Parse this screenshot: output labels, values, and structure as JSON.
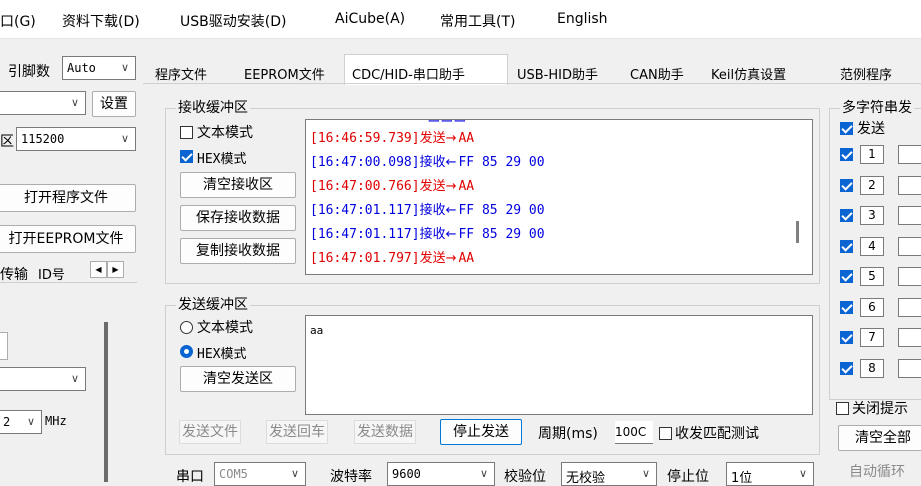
{
  "menu": [
    "口(G)",
    "资料下载(D)",
    "USB驱动安装(D)",
    "AiCube(A)",
    "常用工具(T)",
    "English"
  ],
  "left": {
    "pin_label": "引脚数",
    "pin_value": "Auto",
    "settings_button": "设置",
    "baud_label_fragment": "区",
    "baud_value": "115200",
    "open_program_button": "打开程序文件",
    "open_eeprom_button": "打开EEPROM文件",
    "transfer_label": "传输",
    "id_label": "ID号",
    "mhz_value": "2",
    "mhz_unit": "MHz"
  },
  "tabs": [
    "程序文件",
    "EEPROM文件",
    "CDC/HID-串口助手",
    "USB-HID助手",
    "CAN助手",
    "Keil仿真设置",
    "范例程序"
  ],
  "receive": {
    "title": "接收缓冲区",
    "text_mode": "文本模式",
    "hex_mode": "HEX模式",
    "clear_button": "清空接收区",
    "save_button": "保存接收数据",
    "copy_button": "复制接收数据",
    "log": [
      {
        "time": "[16:46:59.739]",
        "dir": "发送→",
        "data": "AA",
        "color": "#e00000"
      },
      {
        "time": "[16:47:00.098]",
        "dir": "接收←",
        "data": "FF 85 29 00",
        "color": "#0000e0"
      },
      {
        "time": "[16:47:00.766]",
        "dir": "发送→",
        "data": "AA",
        "color": "#e00000"
      },
      {
        "time": "[16:47:01.117]",
        "dir": "接收←",
        "data": "FF 85 29 00",
        "color": "#0000e0"
      },
      {
        "time": "[16:47:01.117]",
        "dir": "接收←",
        "data": "FF 85 29 00",
        "color": "#0000e0"
      },
      {
        "time": "[16:47:01.797]",
        "dir": "发送→",
        "data": "AA",
        "color": "#e00000"
      }
    ]
  },
  "send": {
    "title": "发送缓冲区",
    "text_mode": "文本模式",
    "hex_mode": "HEX模式",
    "clear_button": "清空发送区",
    "content": "aa",
    "send_file": "发送文件",
    "send_enter": "发送回车",
    "send_data": "发送数据",
    "stop_send": "停止发送",
    "period_label": "周期(ms)",
    "period_value": "100C",
    "loopback_label": "收发匹配测试"
  },
  "bottom": {
    "port_label": "串口",
    "port_value": "COM5",
    "baud_label": "波特率",
    "baud_value": "9600",
    "parity_label": "校验位",
    "parity_value": "无校验",
    "stop_label": "停止位",
    "stop_value": "1位"
  },
  "multi": {
    "title": "多字符串发",
    "send_label": "发送",
    "items": [
      "1",
      "2",
      "3",
      "4",
      "5",
      "6",
      "7",
      "8"
    ],
    "close_tip": "关闭提示",
    "clear_all": "清空全部",
    "auto_loop": "自动循环"
  }
}
